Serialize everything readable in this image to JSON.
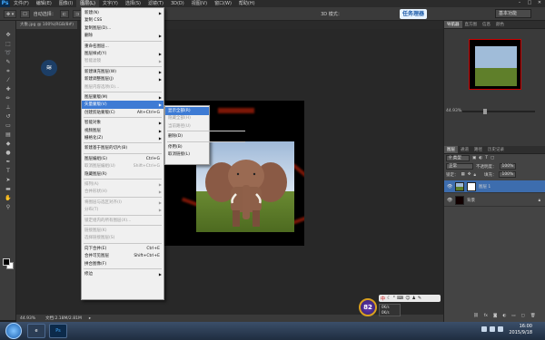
{
  "app": {
    "logo": "Ps"
  },
  "menubar": {
    "items": [
      "文件(F)",
      "编辑(E)",
      "图像(I)",
      "图层(L)",
      "文字(Y)",
      "选择(S)",
      "滤镜(T)",
      "3D(D)",
      "视图(V)",
      "窗口(W)",
      "帮助(H)"
    ],
    "active_index": 3,
    "window_controls": [
      "–",
      "□",
      "✕"
    ]
  },
  "options_bar": {
    "auto_select_label": "自动选择：",
    "mode_3d_label": "3D 模式：",
    "task_label": "任务理器",
    "workspace": "基本功能"
  },
  "document": {
    "tab_label": "大象.jpg @ 100%(RGB/8#)",
    "zoom": "44.93%",
    "doc_size": "文档:2.18M/2.81M"
  },
  "layer_menu": {
    "items": [
      {
        "label": "新建(N)",
        "arrow": true,
        "disabled": false
      },
      {
        "label": "复制 CSS",
        "disabled": false
      },
      {
        "label": "复制图层(D)...",
        "disabled": false
      },
      {
        "label": "删除",
        "arrow": true,
        "disabled": false
      },
      {
        "sep": true
      },
      {
        "label": "重命名图层...",
        "disabled": false
      },
      {
        "label": "图层样式(Y)",
        "arrow": true,
        "disabled": false
      },
      {
        "label": "智能滤镜",
        "arrow": true,
        "disabled": true
      },
      {
        "sep": true
      },
      {
        "label": "新建填充图层(W)",
        "arrow": true,
        "disabled": false
      },
      {
        "label": "新建调整图层(J)",
        "arrow": true,
        "disabled": false
      },
      {
        "label": "图层内容选项(O)...",
        "disabled": true
      },
      {
        "sep": true
      },
      {
        "label": "图层蒙版(M)",
        "arrow": true,
        "disabled": false
      },
      {
        "label": "矢量蒙版(V)",
        "arrow": true,
        "disabled": false,
        "highlighted": true
      },
      {
        "label": "创建剪贴蒙版(C)",
        "shortcut": "Alt+Ctrl+G",
        "disabled": false
      },
      {
        "sep": true
      },
      {
        "label": "智能对象",
        "arrow": true,
        "disabled": false
      },
      {
        "label": "视频图层",
        "arrow": true,
        "disabled": false
      },
      {
        "label": "栅格化(Z)",
        "arrow": true,
        "disabled": false
      },
      {
        "sep": true
      },
      {
        "label": "新建基于图层的切片(B)",
        "disabled": false
      },
      {
        "sep": true
      },
      {
        "label": "图层编组(G)",
        "shortcut": "Ctrl+G",
        "disabled": false
      },
      {
        "label": "取消图层编组(U)",
        "shortcut": "Shift+Ctrl+G",
        "disabled": true
      },
      {
        "label": "隐藏图层(R)",
        "disabled": false
      },
      {
        "sep": true
      },
      {
        "label": "排列(A)",
        "arrow": true,
        "disabled": true
      },
      {
        "label": "合并形状(H)",
        "arrow": true,
        "disabled": true
      },
      {
        "sep": true
      },
      {
        "label": "将图层与选区对齐(I)",
        "arrow": true,
        "disabled": true
      },
      {
        "label": "分布(T)",
        "arrow": true,
        "disabled": true
      },
      {
        "sep": true
      },
      {
        "label": "锁定组内的所有图层(X)...",
        "disabled": true
      },
      {
        "sep": true
      },
      {
        "label": "链接图层(K)",
        "disabled": true
      },
      {
        "label": "选择链接图层(S)",
        "disabled": true
      },
      {
        "sep": true
      },
      {
        "label": "向下合并(E)",
        "shortcut": "Ctrl+E",
        "disabled": false
      },
      {
        "label": "合并可见图层",
        "shortcut": "Shift+Ctrl+E",
        "disabled": false
      },
      {
        "label": "拼合图像(F)",
        "disabled": false
      },
      {
        "sep": true
      },
      {
        "label": "修边",
        "arrow": true,
        "disabled": false
      }
    ]
  },
  "vector_mask_submenu": {
    "items": [
      {
        "label": "显示全部(R)",
        "disabled": true,
        "highlighted": true
      },
      {
        "label": "隐藏全部(H)",
        "disabled": true
      },
      {
        "label": "当前路径(U)",
        "disabled": true
      },
      {
        "sep": true
      },
      {
        "label": "删除(D)",
        "disabled": false
      },
      {
        "sep": true
      },
      {
        "label": "停用(B)",
        "disabled": false
      },
      {
        "label": "取消链接(L)",
        "disabled": false
      }
    ]
  },
  "navigator": {
    "tabs": [
      "导航器",
      "直方图",
      "信息",
      "颜色"
    ],
    "active_tab": 0,
    "zoom": "44.93%",
    "slider_fraction": 0.3
  },
  "layers": {
    "tabs": [
      "图层",
      "通道",
      "路径",
      "历史记录"
    ],
    "active_tab": 0,
    "filter_label": "类型",
    "blend_mode": "正常",
    "opacity_label": "不透明度：",
    "opacity": "100%",
    "lock_label": "锁定：",
    "fill_label": "填充：",
    "fill": "100%",
    "items": [
      {
        "name": "图层 1",
        "selected": true
      },
      {
        "name": "背景",
        "selected": false
      }
    ]
  },
  "tray": {
    "score": "82",
    "badge": "中",
    "speed_up": "0K/s",
    "speed_down": "0K/s"
  },
  "taskbar": {
    "apps": [
      "Ps",
      ""
    ],
    "time": "16:00",
    "date": "2015/9/18"
  },
  "colors": {
    "menu_highlight": "#3e7bd4",
    "layer_selected": "#3d6dae",
    "canvas_bg": "#282828"
  }
}
